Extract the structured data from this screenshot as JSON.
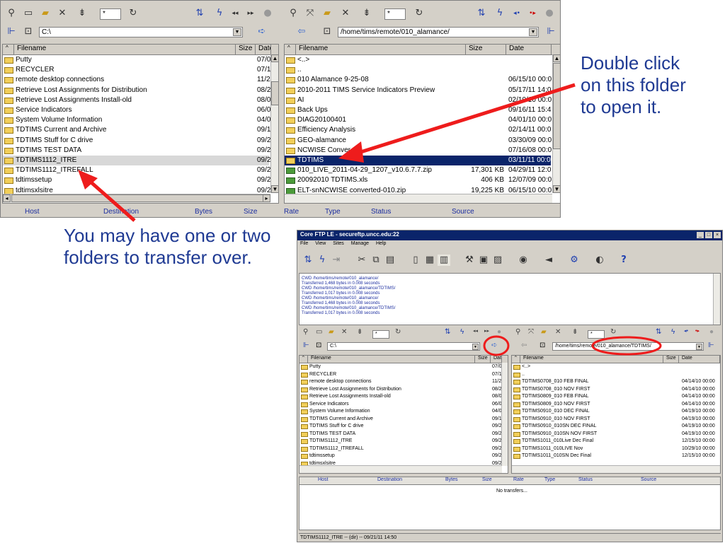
{
  "annotations": {
    "right_text_lines": [
      "Double click",
      "on this folder",
      "to open it."
    ],
    "left_text_lines": [
      "You may have one or two",
      "folders to transfer over."
    ]
  },
  "top_window": {
    "left_pane": {
      "filter_value": "*",
      "path_value": "C:\\",
      "columns": [
        "Filename",
        "Size",
        "Date"
      ],
      "rows": [
        {
          "name": "Putty",
          "size": "",
          "date": "07/0"
        },
        {
          "name": "RECYCLER",
          "size": "",
          "date": "07/1"
        },
        {
          "name": "remote desktop connections",
          "size": "",
          "date": "11/2"
        },
        {
          "name": "Retrieve Lost Assignments for Distribution",
          "size": "",
          "date": "08/2"
        },
        {
          "name": "Retrieve Lost Assignments Install-old",
          "size": "",
          "date": "08/0"
        },
        {
          "name": "Service Indicators",
          "size": "",
          "date": "06/0"
        },
        {
          "name": "System Volume Information",
          "size": "",
          "date": "04/0"
        },
        {
          "name": "TDTIMS Current and Archive",
          "size": "",
          "date": "09/1"
        },
        {
          "name": "TDTIMS Stuff for C drive",
          "size": "",
          "date": "09/2"
        },
        {
          "name": "TDTIMS TEST DATA",
          "size": "",
          "date": "09/2"
        },
        {
          "name": "TDTIMS1112_ITRE",
          "size": "",
          "date": "09/2"
        },
        {
          "name": "TDTIMS1112_ITREFALL",
          "size": "",
          "date": "09/2"
        },
        {
          "name": "tdtimssetup",
          "size": "",
          "date": "09/2"
        },
        {
          "name": "tdtimsxlsitre",
          "size": "",
          "date": "09/2"
        }
      ]
    },
    "right_pane": {
      "filter_value": "*",
      "path_value": "/home/tims/remote/010_alamance/",
      "columns": [
        "Filename",
        "Size",
        "Date"
      ],
      "rows": [
        {
          "name": "<..>",
          "size": "",
          "date": "",
          "type": "folder"
        },
        {
          "name": "..",
          "size": "",
          "date": "",
          "type": "folder"
        },
        {
          "name": "010 Alamance 9-25-08",
          "size": "",
          "date": "06/15/10  00:0",
          "type": "folder"
        },
        {
          "name": "2010-2011 TIMS Service Indicators Preview",
          "size": "",
          "date": "05/17/11  14:0",
          "type": "folder"
        },
        {
          "name": "AI",
          "size": "",
          "date": "02/10/10  00:0",
          "type": "folder"
        },
        {
          "name": "Back Ups",
          "size": "",
          "date": "09/16/11  15:4",
          "type": "folder"
        },
        {
          "name": "DIAG20100401",
          "size": "",
          "date": "04/01/10  00:0",
          "type": "folder"
        },
        {
          "name": "Efficiency Analysis",
          "size": "",
          "date": "02/14/11  00:0",
          "type": "folder"
        },
        {
          "name": "GEO-alamance",
          "size": "",
          "date": "03/30/09  00:0",
          "type": "folder"
        },
        {
          "name": "NCWISE Conver",
          "size": "",
          "date": "07/16/08  00:0",
          "type": "folder"
        },
        {
          "name": "TDTIMS",
          "size": "",
          "date": "03/11/11  00:0",
          "type": "folder"
        },
        {
          "name": "010_LIVE_2011-04-29_1207_v10.6.7.7.zip",
          "size": "17,301 KB",
          "date": "04/29/11  12:0",
          "type": "file"
        },
        {
          "name": "20092010 TDTIMS.xls",
          "size": "406 KB",
          "date": "12/07/09  00:0",
          "type": "file"
        },
        {
          "name": "ELT-snNCWISE converted-010.zip",
          "size": "19,225 KB",
          "date": "06/15/10  00:0",
          "type": "file"
        }
      ]
    },
    "queue_columns": [
      "Host",
      "Destination",
      "Bytes",
      "Size",
      "Rate",
      "Type",
      "Status",
      "Source"
    ]
  },
  "bottom_window": {
    "title": "Core FTP LE - secureftp.uncc.edu:22",
    "menu": [
      "File",
      "View",
      "Sites",
      "Manage",
      "Help"
    ],
    "log_lines": [
      "CWD /home/tims/remote/010_alamance/",
      "Transferred 1,468 bytes in 0.008 seconds",
      "CWD /home/tims/remote/010_alamance/TDTIMS/",
      "Transferred 1,017 bytes in 0.008 seconds",
      "CWD /home/tims/remote/010_alamance/",
      "Transferred 1,468 bytes in 0.008 seconds",
      "CWD /home/tims/remote/010_alamance/TDTIMS/",
      "Transferred 1,017 bytes in 0.008 seconds"
    ],
    "left_pane": {
      "filter_value": "*",
      "path_value": "C:\\",
      "columns": [
        "Filename",
        "Size",
        "Date"
      ],
      "rows": [
        {
          "name": "Putty",
          "date": "07/0"
        },
        {
          "name": "RECYCLER",
          "date": "07/1"
        },
        {
          "name": "remote desktop connections",
          "date": "11/2"
        },
        {
          "name": "Retrieve Lost Assignments for Distribution",
          "date": "08/2"
        },
        {
          "name": "Retrieve Lost Assignments Install-old",
          "date": "08/0"
        },
        {
          "name": "Service Indicators",
          "date": "06/0"
        },
        {
          "name": "System Volume Information",
          "date": "04/0"
        },
        {
          "name": "TDTIMS Current and Archive",
          "date": "09/1"
        },
        {
          "name": "TDTIMS Stuff for C drive",
          "date": "09/2"
        },
        {
          "name": "TDTIMS TEST DATA",
          "date": "09/2"
        },
        {
          "name": "TDTIMS1112_ITRE",
          "date": "09/2"
        },
        {
          "name": "TDTIMS1112_ITREFALL",
          "date": "09/2"
        },
        {
          "name": "tdtimssetup",
          "date": "09/2"
        },
        {
          "name": "tdtimsxlsitre",
          "date": "09/2"
        }
      ]
    },
    "right_pane": {
      "filter_value": "*",
      "path_value": "/home/tims/remote/010_alamance/TDTIMS/",
      "columns": [
        "Filename",
        "Size",
        "Date"
      ],
      "rows": [
        {
          "name": "<..>",
          "date": ""
        },
        {
          "name": "..",
          "date": ""
        },
        {
          "name": "TDTIMS0708_010 FEB FINAL",
          "date": "04/14/10  00:00"
        },
        {
          "name": "TDTIMS0708_010 NOV FIRST",
          "date": "04/14/10  00:00"
        },
        {
          "name": "TDTIMS0809_010 FEB FINAL",
          "date": "04/14/10  00:00"
        },
        {
          "name": "TDTIMS0809_010 NOV FIRST",
          "date": "04/14/10  00:00"
        },
        {
          "name": "TDTIMS0910_010 DEC FINAL",
          "date": "04/19/10  00:00"
        },
        {
          "name": "TDTIMS0910_010 NOV FIRST",
          "date": "04/19/10  00:00"
        },
        {
          "name": "TDTIMS0910_010SN DEC FINAL",
          "date": "04/19/10  00:00"
        },
        {
          "name": "TDTIMS0910_010SN NOV FIRST",
          "date": "04/19/10  00:00"
        },
        {
          "name": "TDTIMS1011_010Live  Dec Final",
          "date": "12/15/10  00:00"
        },
        {
          "name": "TDTIMS1011_010LIVE Nov",
          "date": "10/29/10  00:00"
        },
        {
          "name": "TDTIMS1011_010SN Dec Final",
          "date": "12/15/10  00:00"
        }
      ]
    },
    "queue_columns": [
      "Host",
      "Destination",
      "Bytes",
      "Size",
      "Rate",
      "Type",
      "Status",
      "Source"
    ],
    "queue_empty_text": "No transfers...",
    "status_text": "TDTIMS1112_ITRE -- (dir) -- 09/21/11  14:50"
  },
  "colors": {
    "annotation_text": "#1f3a93",
    "arrow_red": "#ee1c1c",
    "selection_blue": "#0a246a",
    "ui_gray": "#d4d0c8"
  }
}
